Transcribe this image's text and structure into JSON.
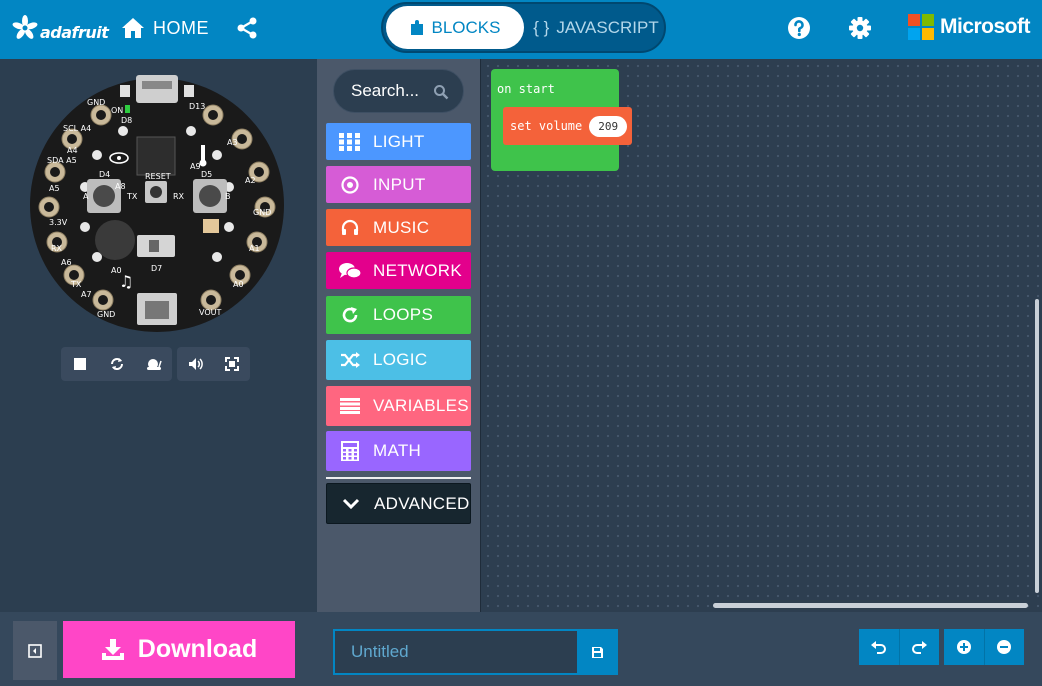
{
  "header": {
    "brand": "adafruit",
    "home_label": "HOME",
    "mode_blocks_label": "BLOCKS",
    "mode_js_label": "JAVASCRIPT",
    "js_glyph": "{ }",
    "microsoft_label": "Microsoft",
    "colors": {
      "bar": "#0286c3",
      "toggle": "#005a8c"
    }
  },
  "simulator": {
    "board_labels": {
      "on": "ON",
      "d13": "D13",
      "d8": "D8",
      "gnd_top": "GND",
      "scl": "SCL A4",
      "sda": "SDA A5",
      "v33": "3.3V",
      "a4": "A4",
      "a5": "A5",
      "a3": "A3",
      "a2": "A2",
      "a1": "A1",
      "a0": "A0",
      "a6": "A6",
      "a7": "A7",
      "a8": "A8",
      "a9": "A9",
      "rx": "RX",
      "tx": "TX",
      "reset": "RESET",
      "d4": "D4",
      "d5": "D5",
      "d7": "D7",
      "vout": "VOUT",
      "gnd_left": "GND",
      "gnd_right": "GND",
      "btn_a": "A",
      "btn_b": "B"
    },
    "controls": [
      "stop-icon",
      "restart-icon",
      "slow-motion-icon",
      "mute-icon",
      "fullscreen-icon"
    ]
  },
  "toolbox": {
    "search_placeholder": "Search...",
    "categories": [
      {
        "label": "LIGHT",
        "color": "#4c97ff",
        "icon": "grid-icon"
      },
      {
        "label": "INPUT",
        "color": "#d65cd6",
        "icon": "target-icon"
      },
      {
        "label": "MUSIC",
        "color": "#f4623a",
        "icon": "headphones-icon"
      },
      {
        "label": "NETWORK",
        "color": "#e3008c",
        "icon": "chat-icon"
      },
      {
        "label": "LOOPS",
        "color": "#3fc34b",
        "icon": "refresh-icon"
      },
      {
        "label": "LOGIC",
        "color": "#4cbfe6",
        "icon": "shuffle-icon"
      },
      {
        "label": "VARIABLES",
        "color": "#ff6680",
        "icon": "list-icon"
      },
      {
        "label": "MATH",
        "color": "#9966ff",
        "icon": "calculator-icon"
      },
      {
        "label": "ADVANCED",
        "color": "#17262f",
        "icon": "chevron-down-icon"
      }
    ]
  },
  "workspace": {
    "on_start_label": "on start",
    "set_volume_label": "set volume",
    "volume_value": "209",
    "colors": {
      "event": "#3fc34b",
      "music": "#f4623a"
    }
  },
  "footer": {
    "download_label": "Download",
    "project_name_placeholder": "Untitled",
    "colors": {
      "download": "#ff46c7",
      "accent": "#0286c3"
    }
  }
}
